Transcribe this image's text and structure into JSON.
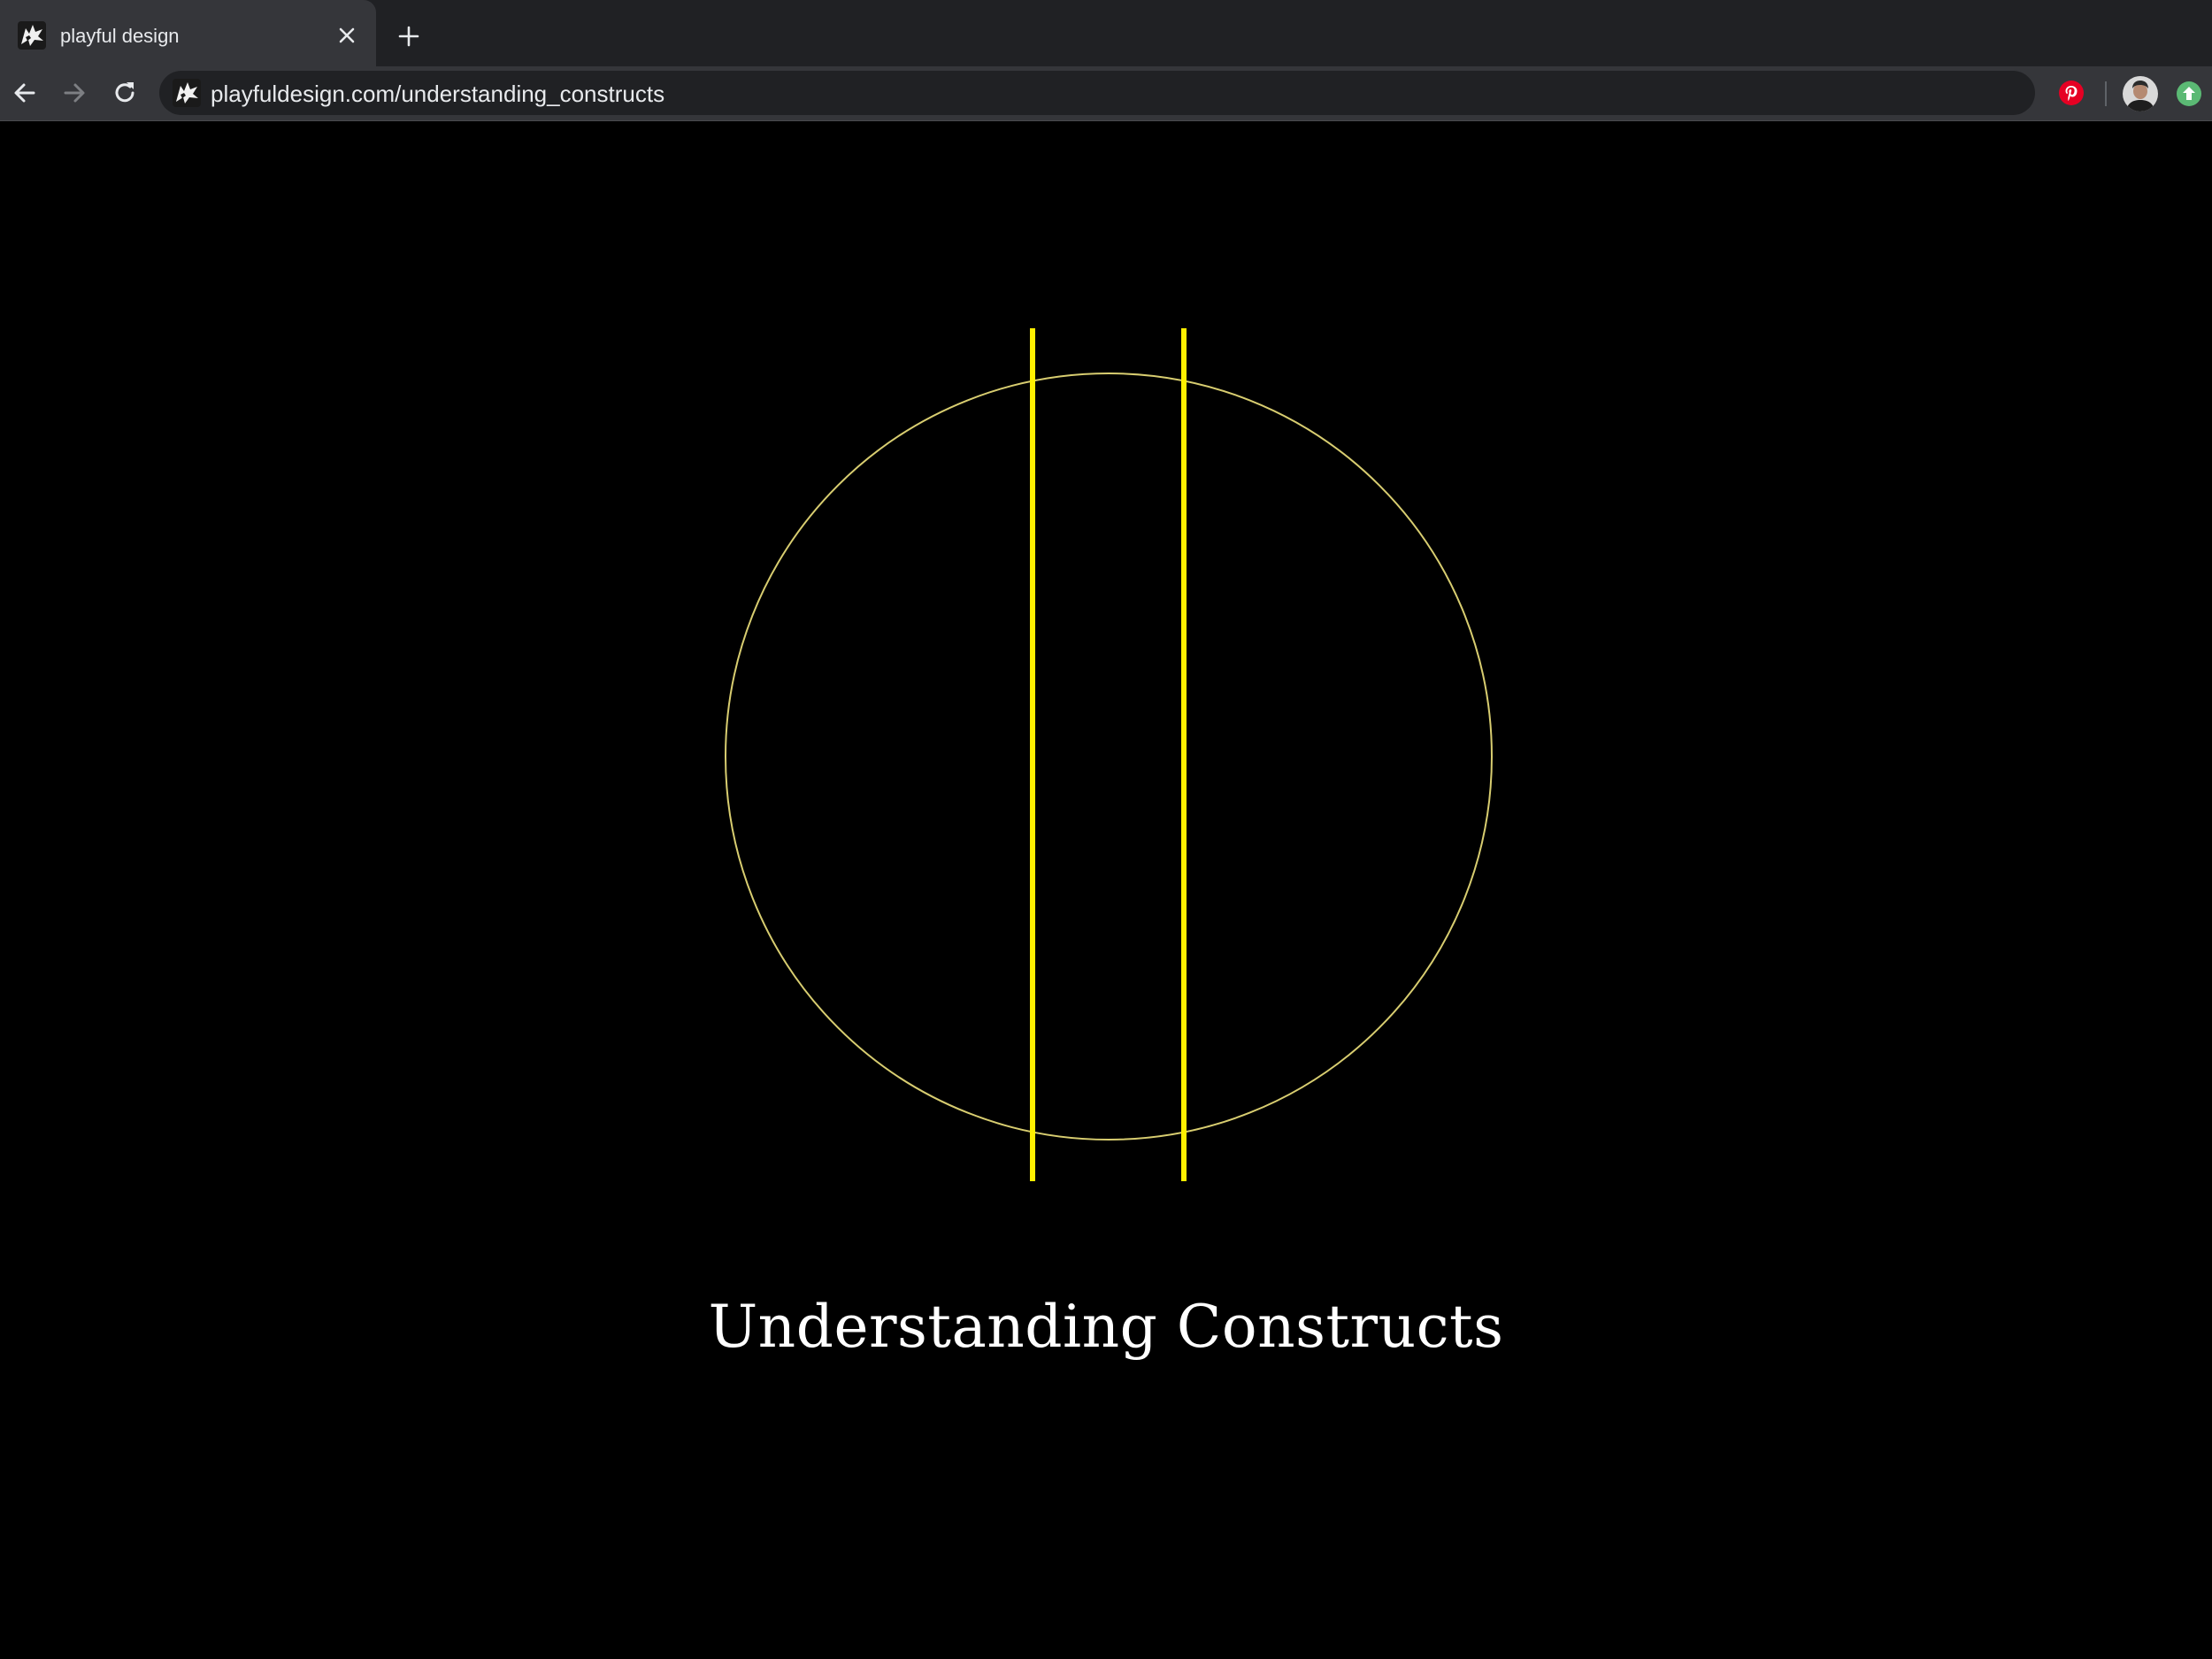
{
  "browser": {
    "tab": {
      "title": "playful design",
      "favicon": "wolf-logo-icon",
      "close_icon": "close-icon"
    },
    "new_tab_icon": "plus-icon",
    "nav": {
      "back_icon": "arrow-left-icon",
      "forward_icon": "arrow-right-icon",
      "reload_icon": "reload-icon"
    },
    "address_bar": {
      "url": "playfuldesign.com/understanding_constructs",
      "favicon": "wolf-logo-icon"
    },
    "extensions": [
      "pinterest-icon"
    ],
    "profile": "avatar",
    "update_icon": "update-available-icon",
    "colors": {
      "tab_strip": "#202124",
      "active_tab": "#35363a",
      "omnibox": "#202124",
      "text": "#e8eaed",
      "pinterest": "#e60023",
      "update": "#5bb974"
    }
  },
  "page": {
    "heading": "Understanding Constructs",
    "illustration": {
      "shape": "circle-with-two-vertical-lines",
      "circle_color": "#d8cd70",
      "line_color": "#ffef00"
    },
    "background": "#000000"
  }
}
